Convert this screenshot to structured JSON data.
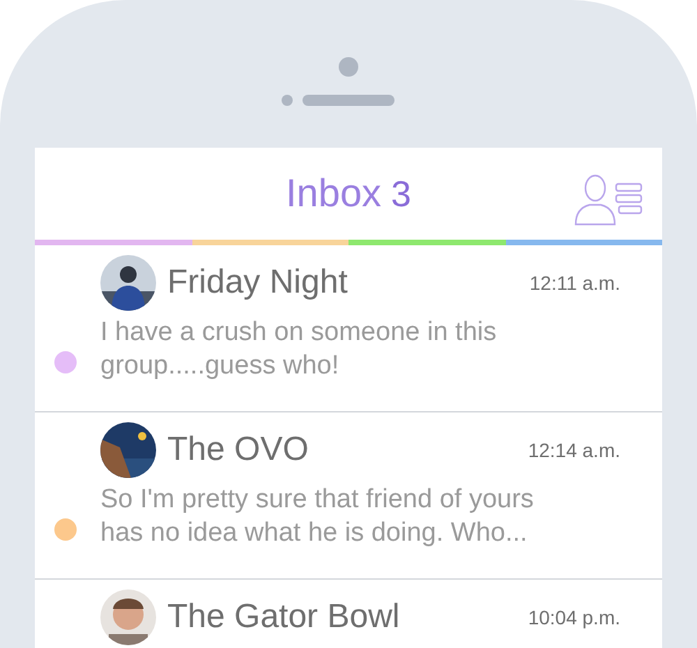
{
  "header": {
    "title": "Inbox",
    "count": "3"
  },
  "stripe": [
    {
      "color": "#e2b6f0"
    },
    {
      "color": "#f8d49a"
    },
    {
      "color": "#8ee86e"
    },
    {
      "color": "#86b8ee"
    }
  ],
  "conversations": [
    {
      "name": "Friday Night",
      "time": "12:11 a.m.",
      "preview": "I have a crush on someone in this group.....guess who!",
      "color": "#e5bdf8"
    },
    {
      "name": "The OVO",
      "time": "12:14 a.m.",
      "preview": "So I'm pretty sure that friend of yours has no idea what he is doing. Who...",
      "color": "#fcc88c"
    },
    {
      "name": "The Gator Bowl",
      "time": "10:04 p.m."
    }
  ]
}
